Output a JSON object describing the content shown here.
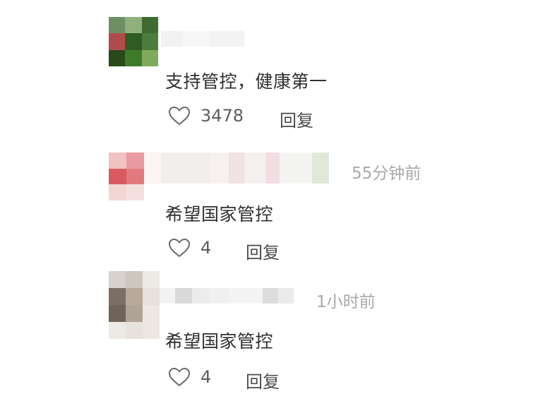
{
  "comments": [
    {
      "text": "支持管控，健康第一",
      "likes": "3478",
      "reply_label": "回复",
      "time": "",
      "avatar_colors": [
        "#6e8f63",
        "#8fb07c",
        "#3f6b31",
        "#b24b4e",
        "#2f5c22",
        "#4c7c3c",
        "#274a18",
        "#3d7a2c",
        "#7faa5c"
      ]
    },
    {
      "text": "希望国家管控",
      "likes": "4",
      "reply_label": "回复",
      "time": "55分钟前",
      "avatar_colors": [
        "#f1c2c2",
        "#e99aa3",
        "#f6dada",
        "#d95a60",
        "#e17a7e",
        "#f3d6d3",
        "#f4e0de",
        "#f3dede",
        "#fbeeee"
      ]
    },
    {
      "text": "希望国家管控",
      "likes": "4",
      "reply_label": "回复",
      "time": "1小时前",
      "avatar_colors": [
        "#d7d2cc",
        "#cdc7c0",
        "#ede9e5",
        "#7c6f66",
        "#b8a999",
        "#e8e2dc",
        "#6f6459",
        "#b0a496",
        "#ece7e2"
      ]
    }
  ]
}
